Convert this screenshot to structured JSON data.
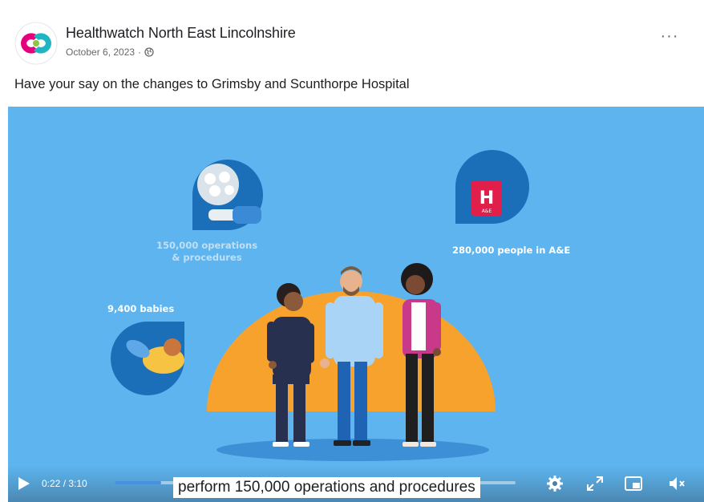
{
  "post": {
    "page_name": "Healthwatch North East Lincolnshire",
    "date": "October 6, 2023",
    "more_label": "···",
    "text": "Have your say on the changes to Grimsby and Scunthorpe Hospital"
  },
  "video": {
    "labels": {
      "operations": "150,000 operations & procedures",
      "operations_line1": "150,000 operations",
      "operations_line2": "& procedures",
      "ae": "280,000 people in A&E",
      "babies": "9,400 babies"
    },
    "hospital_sign": "H",
    "hospital_sign_sub": "A&E",
    "caption": "perform 150,000 operations and procedures",
    "time_current": "0:22",
    "time_total": "3:10",
    "time_display": "0:22 / 3:10",
    "progress_fraction": 0.116,
    "colors": {
      "background": "#5db4ee",
      "sun": "#f7a22c",
      "icon_circle": "#1a6fb8",
      "hospital_red": "#e0204a",
      "progress": "#4a90e2"
    },
    "icons": [
      "play-icon",
      "settings-icon",
      "expand-icon",
      "picture-in-picture-icon",
      "volume-muted-icon"
    ]
  }
}
